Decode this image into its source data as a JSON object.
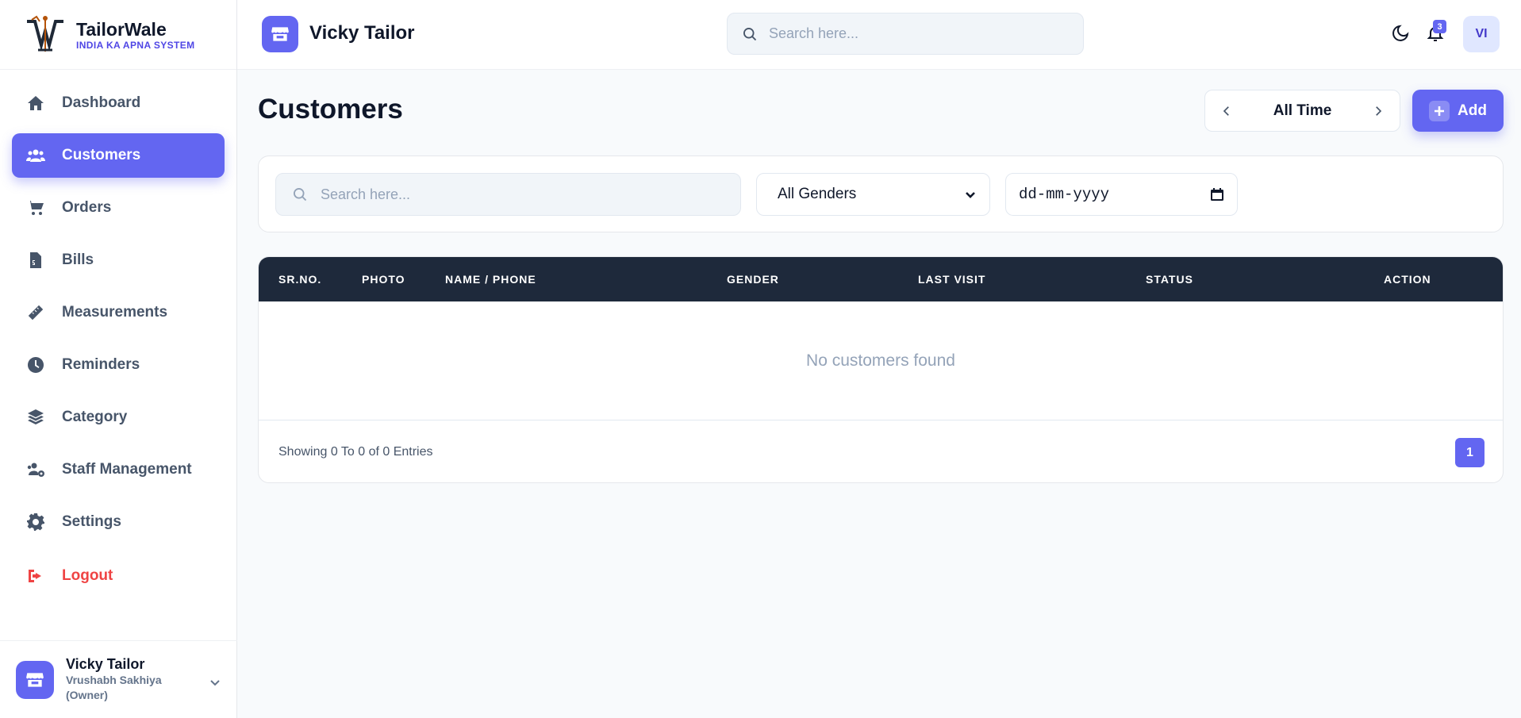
{
  "brand": {
    "name": "TailorWale",
    "tagline": "INDIA KA APNA SYSTEM"
  },
  "sidebar": {
    "items": [
      {
        "label": "Dashboard",
        "icon": "home-icon"
      },
      {
        "label": "Customers",
        "icon": "users-icon",
        "active": true
      },
      {
        "label": "Orders",
        "icon": "cart-icon"
      },
      {
        "label": "Bills",
        "icon": "bill-icon"
      },
      {
        "label": "Measurements",
        "icon": "ruler-icon"
      },
      {
        "label": "Reminders",
        "icon": "clock-icon"
      },
      {
        "label": "Category",
        "icon": "layers-icon"
      },
      {
        "label": "Staff Management",
        "icon": "staff-icon"
      },
      {
        "label": "Settings",
        "icon": "gear-icon"
      }
    ],
    "logout": "Logout"
  },
  "profile": {
    "name": "Vicky Tailor",
    "subtitle": "Vrushabh Sakhiya (Owner)"
  },
  "topbar": {
    "shop_name": "Vicky Tailor",
    "search_placeholder": "Search here...",
    "notification_count": "3",
    "user_initials": "VI"
  },
  "main": {
    "title": "Customers",
    "period_label": "All Time",
    "add_label": "Add",
    "filters": {
      "search_placeholder": "Search here...",
      "gender_selected": "All Genders",
      "date_placeholder": "dd-mm-yyyy"
    },
    "table": {
      "headers": [
        "SR.NO.",
        "PHOTO",
        "NAME / PHONE",
        "GENDER",
        "LAST VISIT",
        "STATUS",
        "ACTION"
      ],
      "empty_message": "No customers found",
      "footer_text": "Showing 0 To 0 of 0 Entries",
      "current_page": "1"
    }
  },
  "colors": {
    "accent": "#6366f1",
    "table_header": "#1e293b",
    "logout": "#ef4444"
  }
}
